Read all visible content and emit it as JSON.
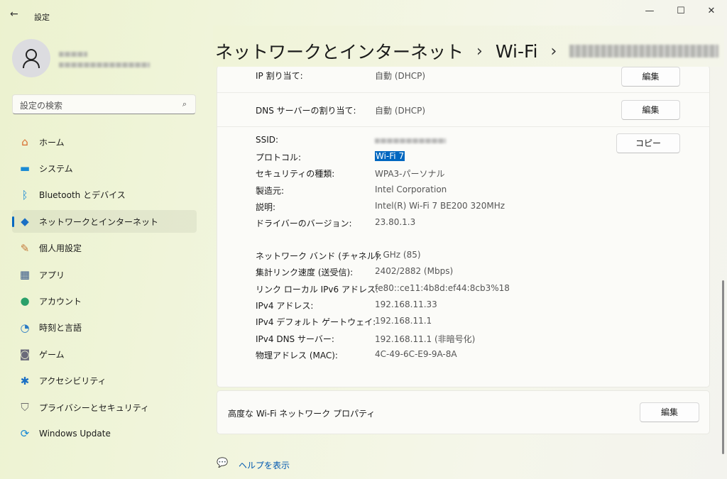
{
  "window": {
    "title": "設定",
    "back": "←",
    "min": "—",
    "max": "☐",
    "close": "✕"
  },
  "search": {
    "placeholder": "設定の検索",
    "icon": "⌕"
  },
  "sidebar": {
    "items": [
      {
        "label": "ホーム",
        "icon": "home-icon",
        "glyph": "⌂",
        "color": "#d86a2c"
      },
      {
        "label": "システム",
        "icon": "system-icon",
        "glyph": "▬",
        "color": "#1a8ad4"
      },
      {
        "label": "Bluetooth とデバイス",
        "icon": "bluetooth-icon",
        "glyph": "ᛒ",
        "color": "#1a8ad4"
      },
      {
        "label": "ネットワークとインターネット",
        "icon": "wifi-icon",
        "glyph": "◆",
        "color": "#1a6fc4"
      },
      {
        "label": "個人用設定",
        "icon": "brush-icon",
        "glyph": "✎",
        "color": "#c47a3a"
      },
      {
        "label": "アプリ",
        "icon": "apps-icon",
        "glyph": "▦",
        "color": "#3a5a8a"
      },
      {
        "label": "アカウント",
        "icon": "account-icon",
        "glyph": "●",
        "color": "#2aa06a"
      },
      {
        "label": "時刻と言語",
        "icon": "clock-globe-icon",
        "glyph": "◔",
        "color": "#2a7ac4"
      },
      {
        "label": "ゲーム",
        "icon": "gamepad-icon",
        "glyph": "◙",
        "color": "#6a6a7a"
      },
      {
        "label": "アクセシビリティ",
        "icon": "accessibility-icon",
        "glyph": "✱",
        "color": "#1a6fc4"
      },
      {
        "label": "プライバシーとセキュリティ",
        "icon": "shield-icon",
        "glyph": "⛉",
        "color": "#6a6a6a"
      },
      {
        "label": "Windows Update",
        "icon": "update-icon",
        "glyph": "⟳",
        "color": "#1a8ad4"
      }
    ]
  },
  "header": {
    "section": "ネットワークとインターネット",
    "sub": "Wi-Fi",
    "sep": "›"
  },
  "ip": {
    "ip_label": "IP 割り当て:",
    "ip_value": "自動 (DHCP)",
    "dns_label": "DNS サーバーの割り当て:",
    "dns_value": "自動 (DHCP)",
    "edit": "編集",
    "copy": "コピー"
  },
  "details": [
    {
      "label": "SSID:",
      "value": null
    },
    {
      "label": "プロトコル:",
      "value": "Wi-Fi 7"
    },
    {
      "label": "セキュリティの種類:",
      "value": "WPA3-パーソナル"
    },
    {
      "label": "製造元:",
      "value": "Intel Corporation"
    },
    {
      "label": "説明:",
      "value": "Intel(R) Wi-Fi 7 BE200 320MHz"
    },
    {
      "label": "ドライバーのバージョン:",
      "value": "23.80.1.3"
    },
    {
      "label": "ネットワーク バンド (チャネル):",
      "value": "6 GHz (85)"
    },
    {
      "label": "集計リンク速度 (送受信):",
      "value": "2402/2882 (Mbps)"
    },
    {
      "label": "リンク ローカル IPv6 アドレス:",
      "value": "fe80::ce11:4b8d:ef44:8cb3%18"
    },
    {
      "label": "IPv4 アドレス:",
      "value": "192.168.11.33"
    },
    {
      "label": "IPv4 デフォルト ゲートウェイ:",
      "value": "192.168.11.1"
    },
    {
      "label": "IPv4 DNS サーバー:",
      "value": "192.168.11.1 (非暗号化)"
    },
    {
      "label": "物理アドレス (MAC):",
      "value": "4C-49-6C-E9-9A-8A"
    }
  ],
  "advanced": {
    "label": "高度な Wi-Fi ネットワーク プロパティ",
    "edit": "編集"
  },
  "help": {
    "label": "ヘルプを表示"
  }
}
